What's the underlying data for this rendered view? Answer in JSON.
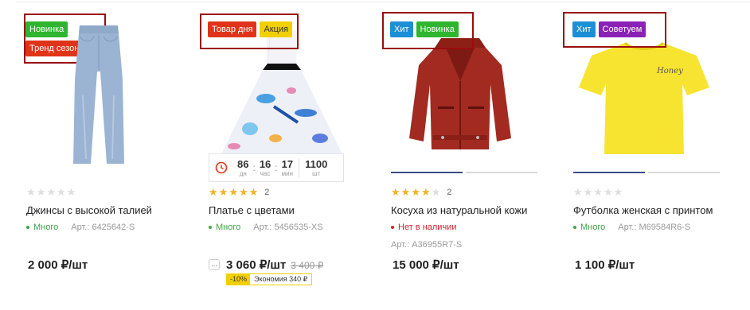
{
  "colors": {
    "accent_frame": "#9b0d0d",
    "star_on": "#f0b323",
    "star_off": "#dedede",
    "in_stock": "#3fa544",
    "out_of_stock": "#d3232e"
  },
  "products": [
    {
      "badges": [
        "Новинка",
        "Тренд сезона"
      ],
      "rating": 0,
      "rating_count": "",
      "title": "Джинсы с высокой талией",
      "stock": "Много",
      "article": "Арт.: 6425642-S",
      "price": "2 000 ₽/шт"
    },
    {
      "badges": [
        "Товар дня",
        "Акция"
      ],
      "timer": {
        "days": "86",
        "days_unit": "дн",
        "hours": "16",
        "hours_unit": "час",
        "minutes": "17",
        "minutes_unit": "мин",
        "qty": "1100",
        "qty_unit": "шт"
      },
      "rating": 5,
      "rating_count": "2",
      "title": "Платье с цветами",
      "stock": "Много",
      "article": "Арт.: 5456535-XS",
      "more": "...",
      "price": "3 060 ₽/шт",
      "old_price": "3 400 ₽",
      "discount_pct": "-10%",
      "discount_text": "Экономия 340 ₽"
    },
    {
      "badges": [
        "Хит",
        "Новинка"
      ],
      "rating": 4,
      "rating_count": "2",
      "title": "Косуха из натуральной кожи",
      "stock": "Нет в наличии",
      "article": "Арт.: A36955R7-S",
      "price": "15 000 ₽/шт"
    },
    {
      "badges": [
        "Хит",
        "Советуем"
      ],
      "rating": 0,
      "rating_count": "",
      "title": "Футболка женская с принтом",
      "stock": "Много",
      "article": "Арт.: M69584R6-S",
      "price": "1 100 ₽/шт",
      "tshirt_print": "Honey"
    }
  ]
}
